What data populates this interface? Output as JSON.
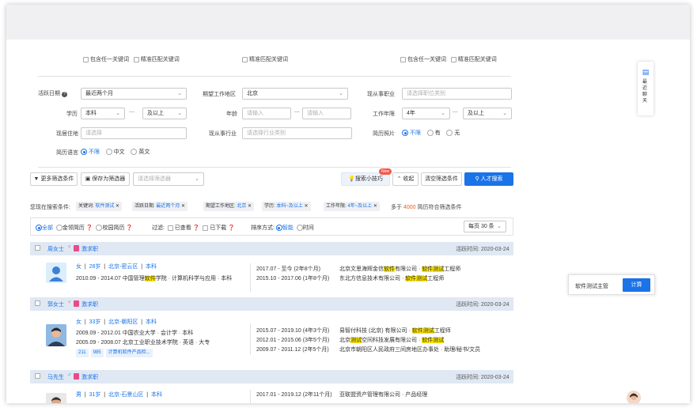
{
  "keyword_opts": {
    "include_any": "包含任一关键词",
    "exact": "精准匹配关键词"
  },
  "filters": {
    "active_date": {
      "label": "活跃日期",
      "value": "最近两个月"
    },
    "expected_area": {
      "label": "期望工作地区",
      "value": "北京"
    },
    "current_job": {
      "label": "现从事职业",
      "placeholder": "请选择职位类别"
    },
    "education": {
      "label": "学历",
      "from": "本科",
      "to": "及以上"
    },
    "age": {
      "label": "年龄",
      "from_ph": "请输入",
      "to_ph": "请输入"
    },
    "work_years": {
      "label": "工作年限",
      "from": "4年",
      "to": "及以上"
    },
    "residence": {
      "label": "现居住地",
      "placeholder": "请选择"
    },
    "current_industry": {
      "label": "现从事行业",
      "placeholder": "请选择行业类别"
    },
    "photo": {
      "label": "简历照片",
      "opts": [
        "不限",
        "有",
        "无"
      ]
    },
    "language": {
      "label": "简历语言",
      "opts": [
        "不限",
        "中文",
        "英文"
      ]
    },
    "dash": "—"
  },
  "toolbar": {
    "more_filters": "更多筛选条件",
    "save_filter": "保存为筛选器",
    "choose_filter_ph": "请选择筛选器",
    "tips": "搜索小技巧",
    "tips_badge": "New",
    "collapse": "收起",
    "clear": "清空筛选条件",
    "search": "人才搜索"
  },
  "conditions": {
    "prefix": "您现在搜索条件:",
    "tags": [
      {
        "k": "关键词:",
        "v": "软件测试"
      },
      {
        "k": "活跃日期:",
        "v": "最近两个月"
      },
      {
        "k": "期望工作地区:",
        "v": "北京"
      },
      {
        "k": "学历:",
        "v": "本科~及以上"
      },
      {
        "k": "工作年限:",
        "v": "4年~及以上"
      }
    ],
    "result_pre": "多于",
    "result_count": "4000",
    "result_post": "简历符合筛选条件"
  },
  "listbar": {
    "types": [
      "全部",
      "金领简历",
      "校园简历"
    ],
    "filter_label": "过滤:",
    "viewed": "已查看",
    "downloaded": "已下载",
    "sort_label": "排序方式:",
    "sort_opts": [
      "智能",
      "时间"
    ],
    "per_page": "每页 30 条"
  },
  "candidates": [
    {
      "name": "周女士",
      "status": "激求职",
      "active": "活跃时间: 2020-03-24",
      "info": [
        "女",
        "28岁",
        "北京-密云区",
        "本科"
      ],
      "edu": [
        {
          "t": "2010.09 - 2014.07  中国管理",
          "h": "软件",
          "r": "学院 · 计算机科学与应用 · 本科"
        }
      ],
      "work": [
        {
          "t": "2017.07 - 至今 (2年8个月)",
          "c": "北京文思海辉金信",
          "h": "软件",
          "m": "有限公司 · ",
          "h2": "软件测试",
          "r": "工程师"
        },
        {
          "t": "2015.10 - 2017.06 (1年8个月)",
          "c": "东北方信息技术有限公司 · ",
          "h": "",
          "m": "",
          "h2": "软件测试",
          "r": "工程师"
        }
      ],
      "chips": []
    },
    {
      "name": "郭女士",
      "status": "激求职",
      "active": "活跃时间: 2020-03-24",
      "info": [
        "女",
        "33岁",
        "北京-朝阳区",
        "本科"
      ],
      "edu": [
        {
          "t": "2009.09 - 2012.01  中国农业大学 · 会计学 · 本科",
          "h": "",
          "r": ""
        },
        {
          "t": "2005.09 - 2008.07  北京工业职业技术学院 · 英语 · 大专",
          "h": "",
          "r": ""
        }
      ],
      "work": [
        {
          "t": "2015.07 - 2019.10 (4年3个月)",
          "c": "易智付科技 (北京) 有限公司 · ",
          "h": "",
          "m": "",
          "h2": "软件测试",
          "r": "工程师"
        },
        {
          "t": "2012.01 - 2015.06 (3年5个月)",
          "c": "北京",
          "h": "测试",
          "m": "空间科技发展有限公司 · ",
          "h2": "软件测试",
          "r": ""
        },
        {
          "t": "2009.07 - 2011.12 (2年5个月)",
          "c": "北京市朝阳区人民政府三间房地区办事处 · 助理/秘书/文员",
          "h": "",
          "m": "",
          "h2": "",
          "r": ""
        }
      ],
      "chips": [
        "211",
        "985",
        "计算机软件产品检..."
      ]
    },
    {
      "name": "马先生",
      "status": "激求职",
      "active": "活跃时间: 2020-03-24",
      "info": [
        "男",
        "31岁",
        "北京-石景山区",
        "本科"
      ],
      "edu": [],
      "work": [
        {
          "t": "2017.01 - 2019.12 (2年11个月)",
          "c": "亚联盟资产管理有限公司 · 产品经理",
          "h": "",
          "m": "",
          "h2": "",
          "r": ""
        }
      ],
      "chips": []
    }
  ],
  "side": {
    "recent": "最近聊天",
    "calc_value": "软件测试主管",
    "calc_button": "计算"
  },
  "colors": {
    "accent": "#1a73e8",
    "highlight": "#ffe600",
    "header_bg": "#dfe8f3"
  }
}
